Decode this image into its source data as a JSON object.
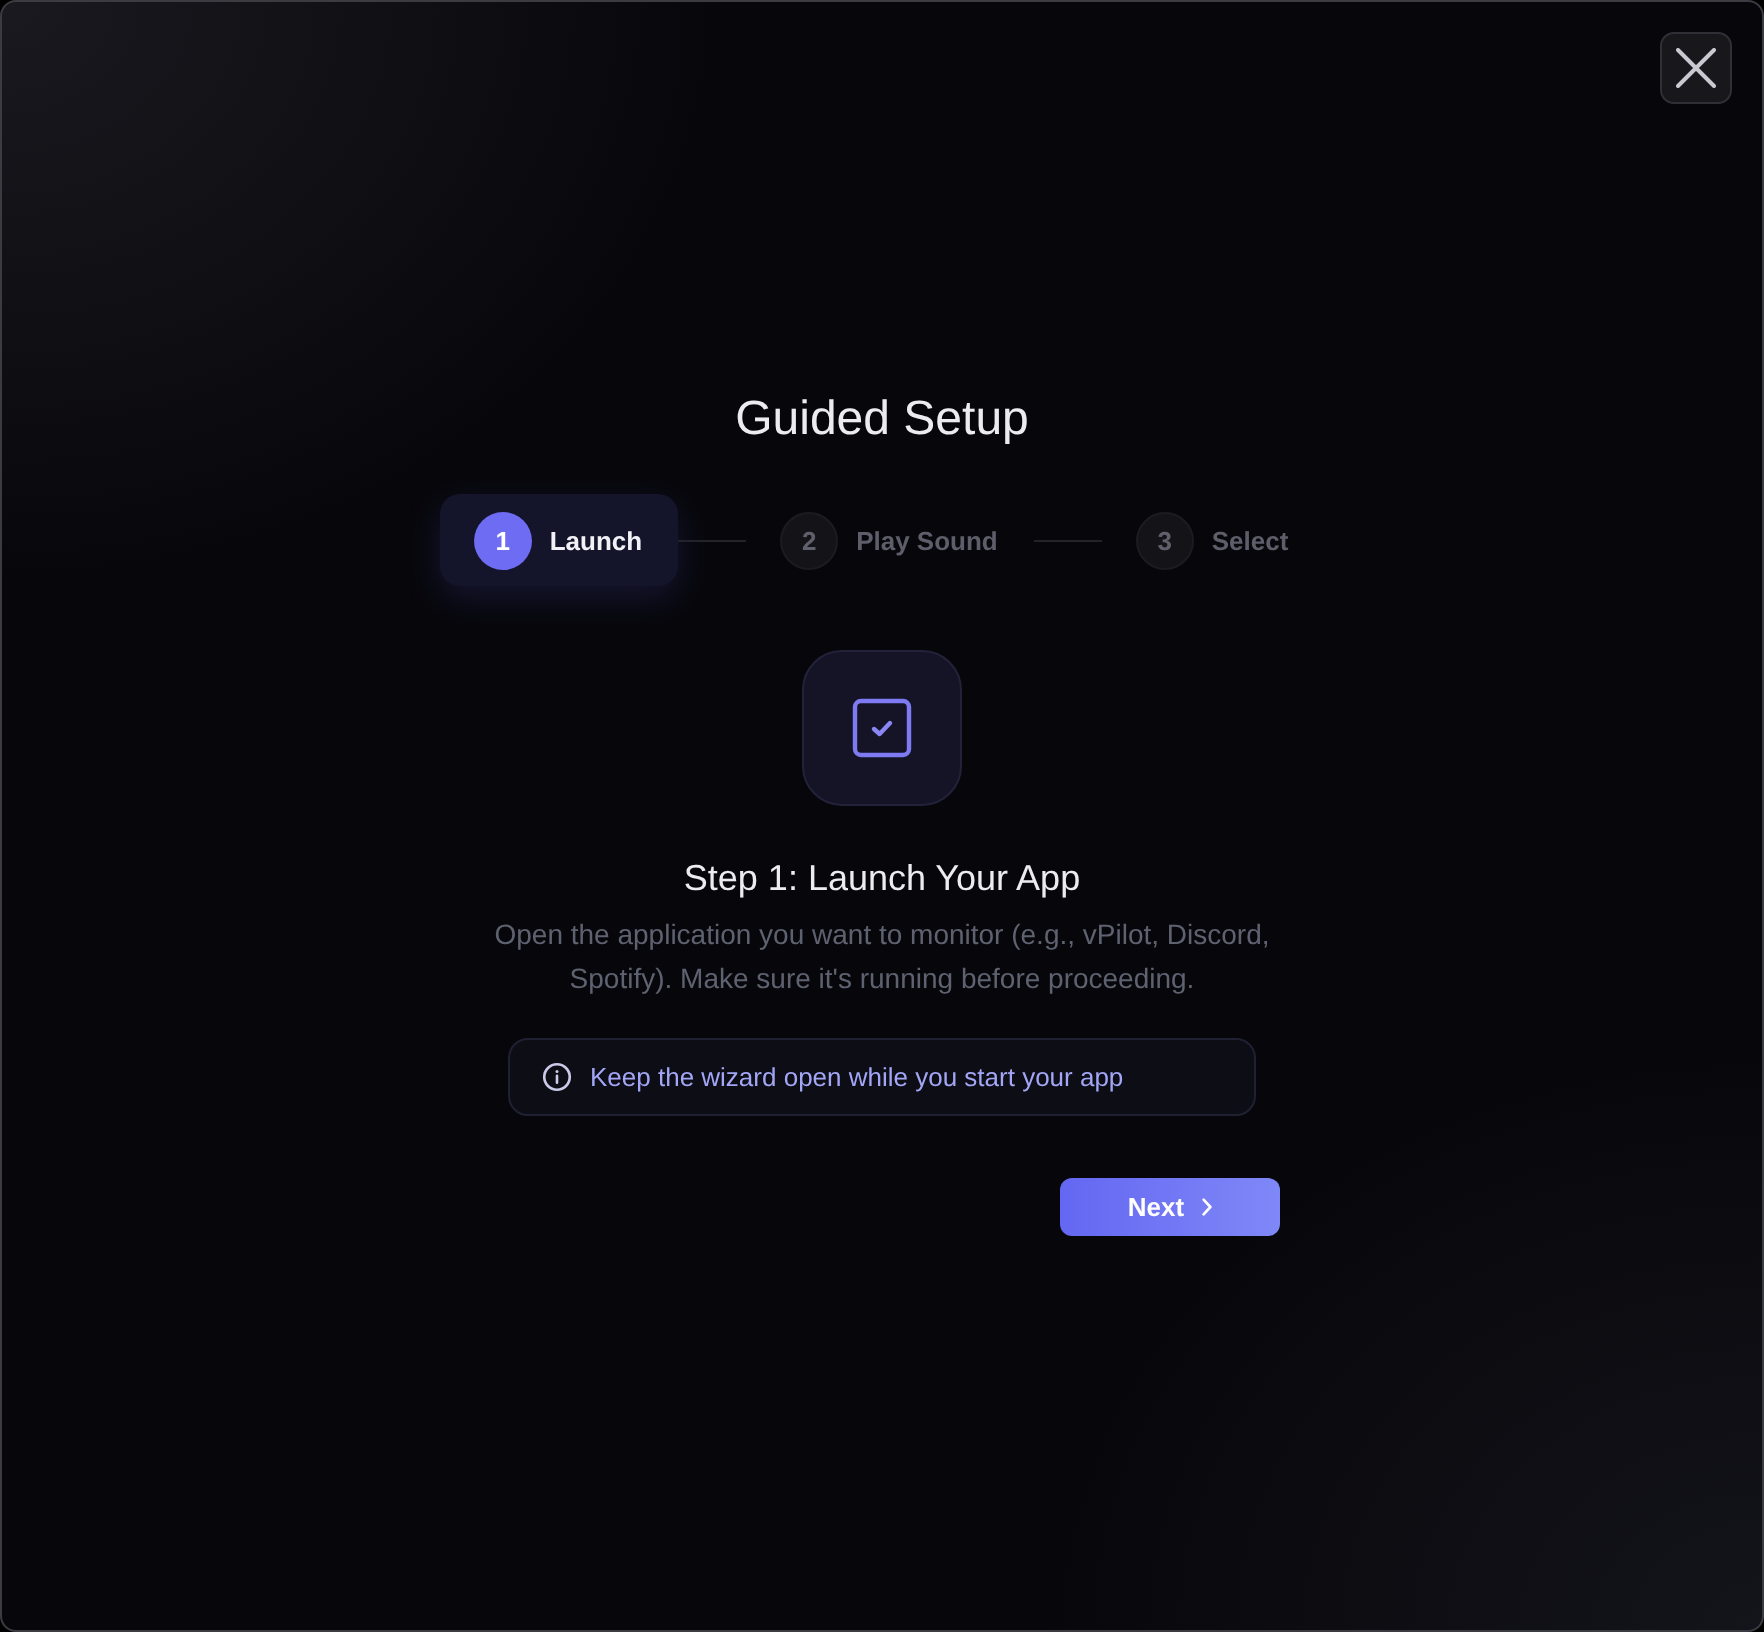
{
  "title": "Guided Setup",
  "steps": [
    {
      "number": "1",
      "label": "Launch",
      "selected": true
    },
    {
      "number": "2",
      "label": "Play Sound",
      "selected": false
    },
    {
      "number": "3",
      "label": "Select",
      "selected": false
    }
  ],
  "step_content": {
    "heading": "Step 1: Launch Your App",
    "description": "Open the application you want to monitor (e.g., vPilot, Discord, Spotify). Make sure it's running before proceeding.",
    "info": "Keep the wizard open while you start your app"
  },
  "next_button": {
    "label": "Next"
  }
}
